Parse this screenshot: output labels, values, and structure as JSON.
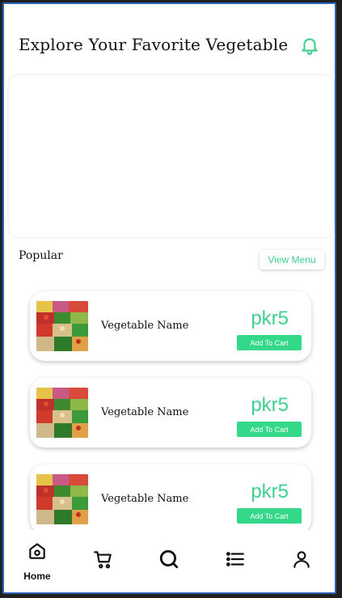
{
  "header": {
    "title": "Explore Your Favorite Vegetable",
    "notification_icon": "bell-icon"
  },
  "section": {
    "title": "Popular",
    "view_menu_label": "View Menu"
  },
  "products": [
    {
      "name": "Vegetable Name",
      "price": "pkr5",
      "button_label": "Add To Cart"
    },
    {
      "name": "Vegetable Name",
      "price": "pkr5",
      "button_label": "Add To Cart"
    },
    {
      "name": "Vegetable Name",
      "price": "pkr5",
      "button_label": "Add To Cart"
    }
  ],
  "bottom_nav": [
    {
      "label": "Home",
      "icon": "home-icon",
      "active": true
    },
    {
      "label": "",
      "icon": "cart-icon"
    },
    {
      "label": "",
      "icon": "search-icon"
    },
    {
      "label": "",
      "icon": "list-icon"
    },
    {
      "label": "",
      "icon": "profile-icon"
    }
  ],
  "colors": {
    "accent": "#3fd08f",
    "button": "#33d889",
    "frame": "#2c64b8"
  }
}
